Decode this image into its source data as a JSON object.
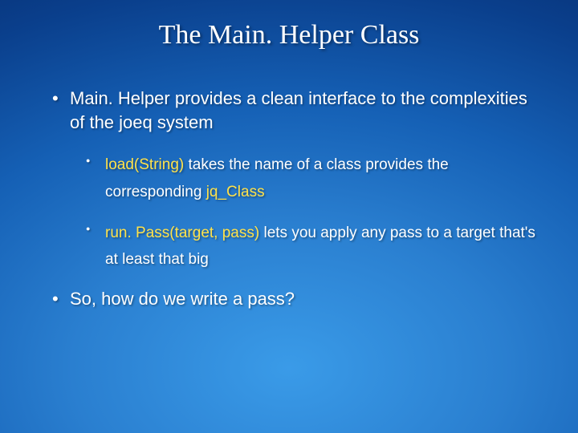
{
  "title": "The Main. Helper Class",
  "bullets": [
    {
      "level": 1,
      "segments": [
        {
          "text": "Main. Helper provides a clean interface to the complexities of the joeq system",
          "highlight": false
        }
      ]
    },
    {
      "level": 2,
      "segments": [
        {
          "text": "load(String)",
          "highlight": true
        },
        {
          "text": " takes the name of a class provides the corresponding ",
          "highlight": false
        },
        {
          "text": "jq_Class",
          "highlight": true
        }
      ]
    },
    {
      "level": 2,
      "segments": [
        {
          "text": "run. Pass(target, pass)",
          "highlight": true
        },
        {
          "text": " lets you apply any pass to a target that's at least that big",
          "highlight": false
        }
      ]
    },
    {
      "level": 1,
      "segments": [
        {
          "text": "So, how do we write a pass?",
          "highlight": false
        }
      ]
    }
  ]
}
